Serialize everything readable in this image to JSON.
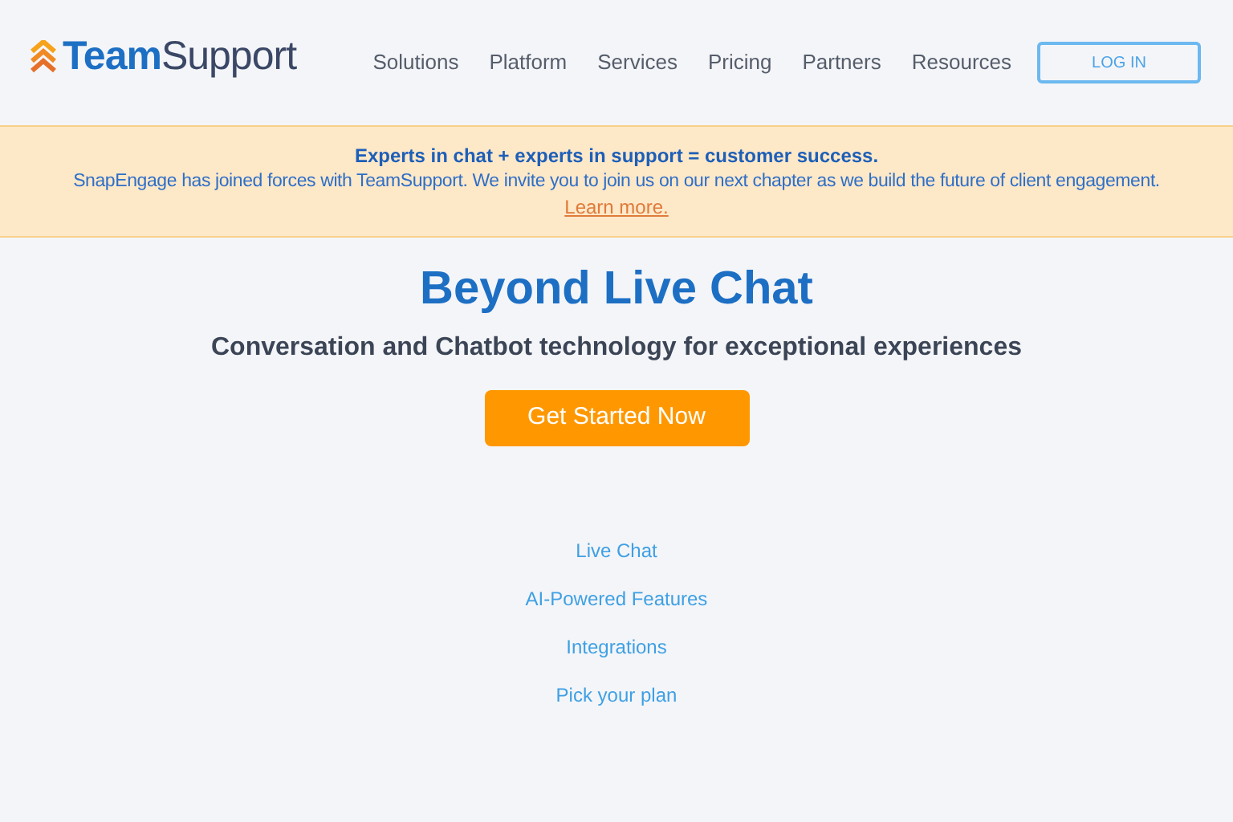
{
  "header": {
    "logo": "**Team**Support",
    "nav": [
      "Solutions",
      "Platform",
      "Services",
      "Pricing",
      "Partners",
      "Resources"
    ],
    "login_button": "LOG IN"
  },
  "banner": {
    "headline": "Experts in chat + experts in support = customer success.",
    "message": "SnapEngage has joined forces with TeamSupport. We invite you to join us on our next chapter as we build the future of client engagement.",
    "link": "Learn more."
  },
  "hero": {
    "title": "Beyond Live Chat",
    "subtitle": "Conversation and Chatbot technology for exceptional experiences",
    "cta": "Get Started Now"
  },
  "links": [
    "Live Chat",
    "AI-Powered Features",
    "Integrations",
    "Pick your plan"
  ]
}
